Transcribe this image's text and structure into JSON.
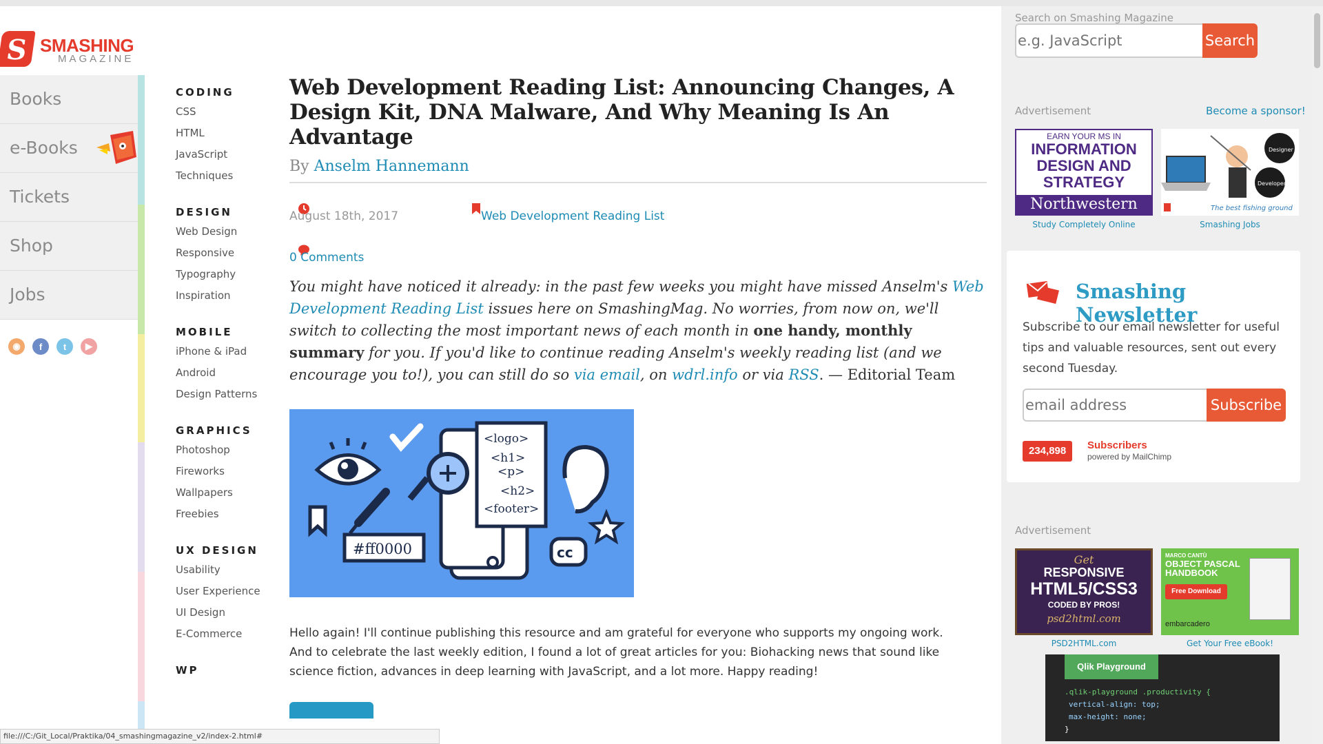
{
  "logo": {
    "name": "SMASHING",
    "sub": "MAGAZINE"
  },
  "main_nav": [
    "Books",
    "e-Books",
    "Tickets",
    "Shop",
    "Jobs"
  ],
  "social_icons": [
    "rss-icon",
    "facebook-icon",
    "twitter-icon",
    "youtube-icon"
  ],
  "categories": [
    {
      "title": "CODING",
      "color": "#b7e3e3",
      "items": [
        "CSS",
        "HTML",
        "JavaScript",
        "Techniques"
      ]
    },
    {
      "title": "DESIGN",
      "color": "#c7e8a8",
      "items": [
        "Web Design",
        "Responsive",
        "Typography",
        "Inspiration"
      ]
    },
    {
      "title": "MOBILE",
      "color": "#f3eea0",
      "items": [
        "iPhone & iPad",
        "Android",
        "Design Patterns"
      ]
    },
    {
      "title": "GRAPHICS",
      "color": "#e3dcef",
      "items": [
        "Photoshop",
        "Fireworks",
        "Wallpapers",
        "Freebies"
      ]
    },
    {
      "title": "UX DESIGN",
      "color": "#f9d7de",
      "items": [
        "Usability",
        "User Experience",
        "UI Design",
        "E-Commerce"
      ]
    },
    {
      "title": "WP",
      "color": "#cde6f5",
      "items": []
    }
  ],
  "article": {
    "title": "Web Development Reading List: Announcing Changes, A Design Kit, DNA Malware, And Why Meaning Is An Advantage",
    "by": "By",
    "author": "Anselm Hannemann",
    "date": "August 18th, 2017",
    "category": "Web Development Reading List",
    "comments": "0 Comments",
    "intro": {
      "p1": "You might have noticed it already: in the past few weeks you might have missed Anselm's ",
      "link1": "Web Development Reading List",
      "p2": " issues here on SmashingMag. No worries, from now on, we'll switch to collecting the most important news of each month in ",
      "bold": "one handy, monthly summary",
      "p3": " for you. If you'd like to continue reading Anselm's weekly reading list (and we encourage you to!), you can still do so ",
      "link2": "via email",
      "p4": ", on ",
      "link3": "wdrl.info",
      "p5": " or via ",
      "link4": "RSS",
      "p6": ". — Editorial Team"
    },
    "hero_code": [
      "<logo>",
      "<h1>",
      "<p>",
      "<h2>",
      "<footer>"
    ],
    "hero_color_tag": "#ff0000",
    "hero_cc": "cc",
    "body": "Hello again! I'll continue publishing this resource and am grateful for everyone who supports my ongoing work. And to celebrate the last weekly edition, I found a lot of great articles for you: Biohacking news that sound like science fiction, advances in deep learning with JavaScript, and a lot more. Happy reading!"
  },
  "sidebar": {
    "search_label": "Search on Smashing Magazine",
    "search_placeholder": "e.g. JavaScript",
    "search_button": "Search",
    "ad_label": "Advertisement",
    "become_sponsor": "Become a sponsor!",
    "ad1": {
      "line1": "EARN YOUR MS IN",
      "line2": "INFORMATION",
      "line3": "DESIGN AND",
      "line4": "STRATEGY",
      "line5": "Northwestern",
      "caption": "Study Completely Online"
    },
    "ad2": {
      "badge1": "Designer",
      "badge2": "Developer",
      "tagline": "The best fishing ground",
      "caption": "Smashing Jobs"
    },
    "newsletter": {
      "title": "Smashing Newsletter",
      "text": "Subscribe to our email newsletter for useful tips and valuable resources, sent out every second Tuesday.",
      "placeholder": "email address",
      "button": "Subscribe",
      "count": "234,898",
      "subscribers": "Subscribers",
      "powered": "powered by MailChimp"
    },
    "ad3": {
      "top": "Get",
      "line1": "RESPONSIVE",
      "line2": "HTML5/CSS3",
      "line3": "CODED BY PROS!",
      "url": "psd2html.com",
      "caption": "PSD2HTML.com"
    },
    "ad4": {
      "author": "MARCO CANTÙ",
      "title": "OBJECT PASCAL HANDBOOK",
      "button": "Free Download",
      "brand": "embarcadero",
      "caption": "Get Your Free eBook!"
    },
    "ad5": {
      "badge": "Qlik Playground",
      "code1": ".qlik-playground .productivity {",
      "code2": "vertical-align: top;",
      "code3": "max-height: none;",
      "code4": "}"
    }
  },
  "status_url": "file:///C:/Git_Local/Praktika/04_smashingmagazine_v2/index-2.html#"
}
